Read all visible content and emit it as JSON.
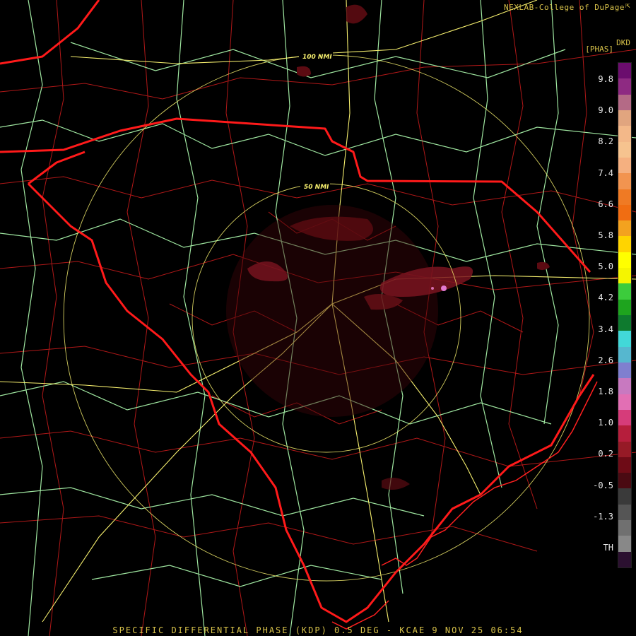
{
  "credit": "NEXLAB-College of DuPage",
  "credit_icon": "arrow-icon",
  "site_id": "DKD",
  "product_unit": "[PHAS]",
  "footer": "SPECIFIC DIFFERENTIAL PHASE (KDP) 0.5 DEG - KCAE 9 NOV 25 06:54",
  "ring_labels": {
    "inner": "50 NMI",
    "outer": "100 NMI"
  },
  "scale": {
    "labels": [
      "9.8",
      "9.0",
      "8.2",
      "7.4",
      "6.6",
      "5.8",
      "5.0",
      "4.2",
      "3.4",
      "2.6",
      "1.8",
      "1.0",
      "0.2",
      "-0.5",
      "-1.3",
      "TH"
    ],
    "colors": [
      "#6b0d6e",
      "#8e2a82",
      "#b46a86",
      "#e1a57f",
      "#f3b889",
      "#f6c38f",
      "#f5b080",
      "#f29450",
      "#ef7a24",
      "#f06d12",
      "#f3a21f",
      "#ffd400",
      "#ffff00",
      "#f5f500",
      "#3ccc3c",
      "#1ea41e",
      "#0e7a2e",
      "#42d8d8",
      "#56b7cf",
      "#7f7fcf",
      "#c879c0",
      "#e26fb4",
      "#d63c7a",
      "#b61e3c",
      "#961a26",
      "#6e0b16",
      "#4a0a12",
      "#3a3a3a",
      "#555555",
      "#707070",
      "#888888",
      "#2b1030"
    ],
    "colors_name": "KDP color scale"
  },
  "colors": {
    "state_border": "#ff1a1a",
    "county": "#b01818",
    "roads": "#9fe6a0",
    "interstates": "#f6ef6e",
    "echo": "#5c0b12"
  }
}
